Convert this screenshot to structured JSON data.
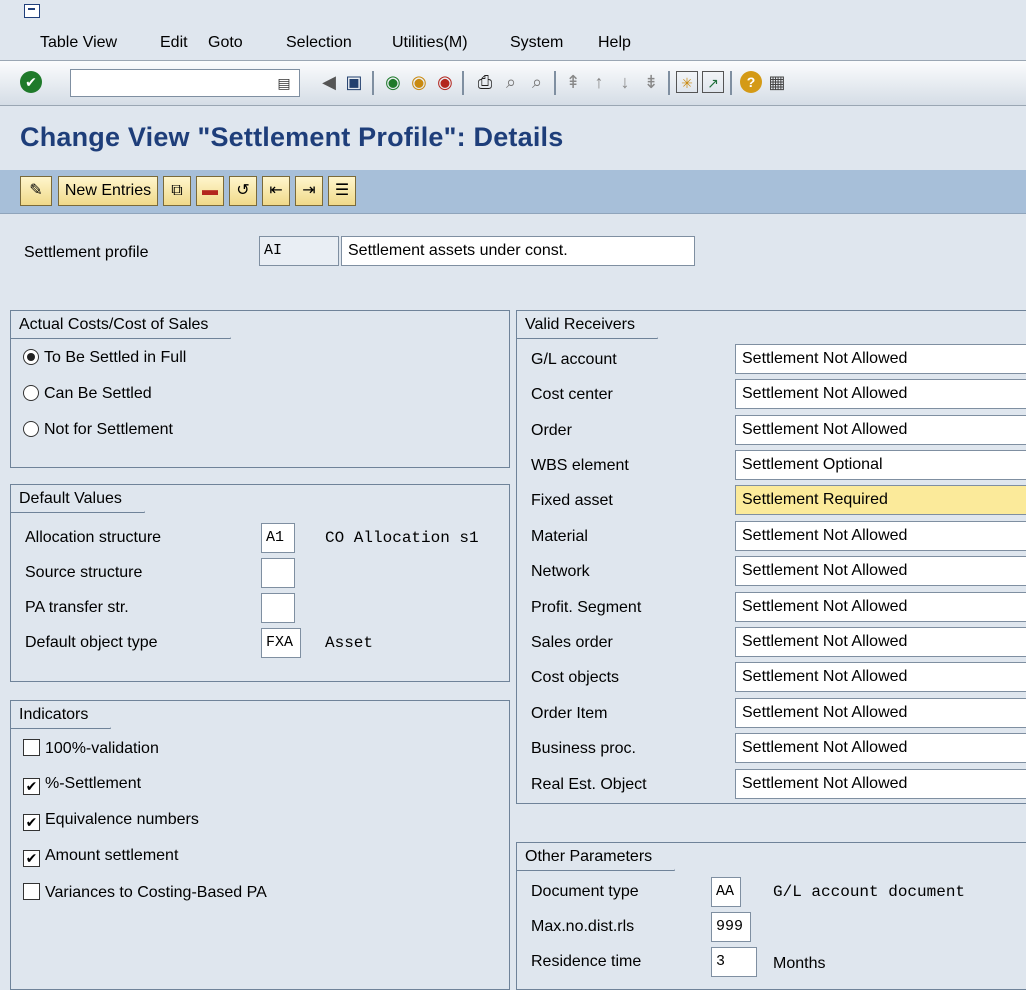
{
  "menu": [
    "Table View",
    "Edit",
    "Goto",
    "Selection",
    "Utilities(M)",
    "System",
    "Help"
  ],
  "toolbar": {
    "command_value": "",
    "icons": [
      "enter-icon",
      "dropdown-icon",
      "back-nav-icon",
      "save-icon",
      "back-icon",
      "exit-icon",
      "cancel-icon",
      "print-icon",
      "find-icon",
      "find-next-icon",
      "first-page-icon",
      "prev-page-icon",
      "next-page-icon",
      "last-page-icon",
      "new-session-icon",
      "shortcut-icon",
      "help-icon",
      "customize-layout-icon"
    ]
  },
  "title": "Change View \"Settlement Profile\": Details",
  "app_toolbar": {
    "new_entries": "New Entries"
  },
  "settlement_profile": {
    "label": "Settlement profile",
    "key": "AI",
    "description": "Settlement assets under const."
  },
  "actual_costs": {
    "title": "Actual Costs/Cost of Sales",
    "options": [
      {
        "label": "To Be Settled in Full",
        "selected": true
      },
      {
        "label": "Can Be Settled",
        "selected": false
      },
      {
        "label": "Not for Settlement",
        "selected": false
      }
    ]
  },
  "default_values": {
    "title": "Default Values",
    "allocation_structure": {
      "label": "Allocation structure",
      "value": "A1",
      "text": "CO Allocation s1"
    },
    "source_structure": {
      "label": "Source structure",
      "value": ""
    },
    "pa_transfer": {
      "label": "PA transfer str.",
      "value": ""
    },
    "default_object_type": {
      "label": "Default object type",
      "value": "FXA",
      "text": "Asset"
    }
  },
  "indicators": {
    "title": "Indicators",
    "items": [
      {
        "label": "100%-validation",
        "checked": false
      },
      {
        "label": "%-Settlement",
        "checked": true
      },
      {
        "label": "Equivalence numbers",
        "checked": true
      },
      {
        "label": "Amount settlement",
        "checked": true
      },
      {
        "label": "Variances to Costing-Based PA",
        "checked": false
      }
    ]
  },
  "valid_receivers": {
    "title": "Valid Receivers",
    "rows": [
      {
        "label": "G/L account",
        "value": "Settlement Not Allowed"
      },
      {
        "label": "Cost center",
        "value": "Settlement Not Allowed"
      },
      {
        "label": "Order",
        "value": "Settlement Not Allowed"
      },
      {
        "label": "WBS element",
        "value": "Settlement Optional"
      },
      {
        "label": "Fixed asset",
        "value": "Settlement Required"
      },
      {
        "label": "Material",
        "value": "Settlement Not Allowed"
      },
      {
        "label": "Network",
        "value": "Settlement Not Allowed"
      },
      {
        "label": "Profit. Segment",
        "value": "Settlement Not Allowed"
      },
      {
        "label": "Sales order",
        "value": "Settlement Not Allowed"
      },
      {
        "label": "Cost objects",
        "value": "Settlement Not Allowed"
      },
      {
        "label": "Order Item",
        "value": "Settlement Not Allowed"
      },
      {
        "label": "Business proc.",
        "value": "Settlement Not Allowed"
      },
      {
        "label": "Real Est. Object",
        "value": "Settlement Not Allowed"
      }
    ]
  },
  "other_parameters": {
    "title": "Other Parameters",
    "document_type": {
      "label": "Document type",
      "value": "AA",
      "text": "G/L account document"
    },
    "max_dist_rules": {
      "label": "Max.no.dist.rls",
      "value": "999"
    },
    "residence_time": {
      "label": "Residence time",
      "value": "3",
      "text": "Months"
    }
  },
  "colors": {
    "title": "#1e3e7a",
    "background": "#dfe6ee",
    "app_toolbar": "#a7bfd9",
    "required_field": "#fbea9a"
  }
}
